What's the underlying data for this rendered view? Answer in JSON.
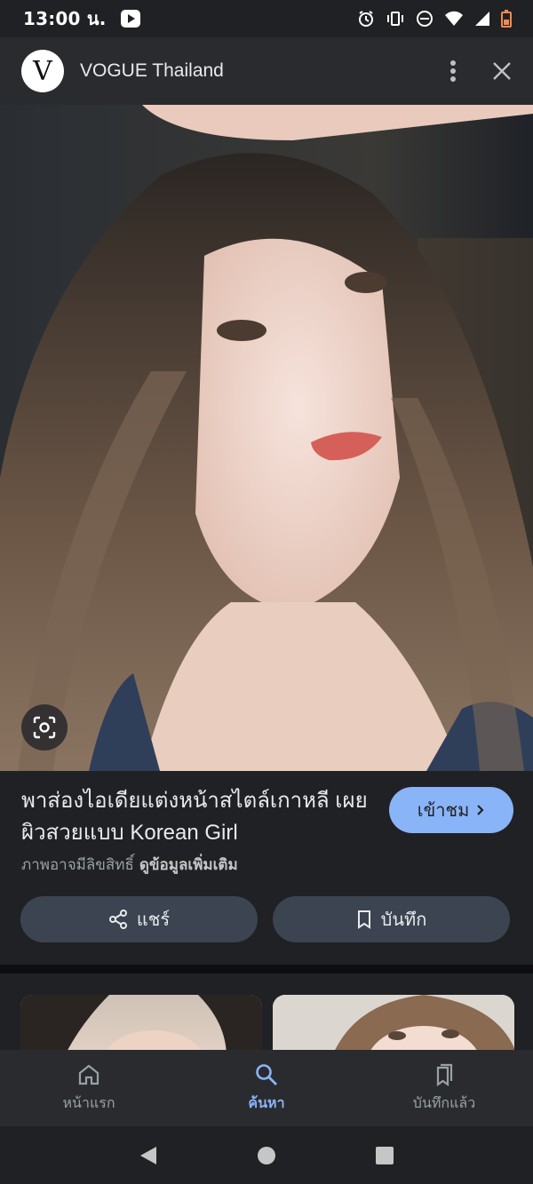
{
  "status_bar": {
    "time": "13:00 น.",
    "icons": [
      "youtube-notification-icon",
      "alarm-icon",
      "vibrate-icon",
      "do-not-disturb-icon",
      "wifi-icon",
      "signal-icon",
      "battery-icon"
    ]
  },
  "header": {
    "logo_letter": "V",
    "site_name": "VOGUE Thailand"
  },
  "result": {
    "title": "พาส่องไอเดียแต่งหน้าสไตล์เกาหลี เผยผิวสวยแบบ Korean Girl",
    "visit_label": "เข้าชม",
    "copyright_note": "ภาพอาจมีลิขสิทธิ์",
    "more_info": "ดูข้อมูลเพิ่มเติม",
    "share_label": "แชร์",
    "save_label": "บันทึก"
  },
  "bottom_nav": {
    "items": [
      {
        "label": "หน้าแรก",
        "icon": "home-icon",
        "active": false
      },
      {
        "label": "ค้นหา",
        "icon": "search-icon",
        "active": true
      },
      {
        "label": "บันทึกแล้ว",
        "icon": "saved-icon",
        "active": false
      }
    ]
  },
  "colors": {
    "background": "#202124",
    "accent": "#8ab4f8",
    "pill": "#3c4452"
  }
}
